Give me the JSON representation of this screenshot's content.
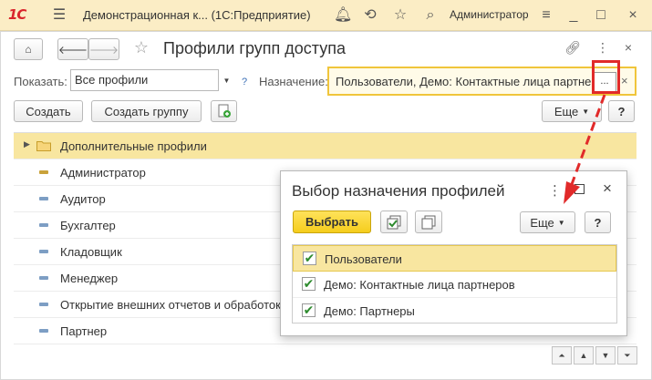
{
  "titlebar": {
    "logo": "1С",
    "title": "Демонстрационная к...  (1С:Предприятие)",
    "user": "Администратор"
  },
  "form": {
    "title": "Профили групп доступа",
    "filter": {
      "show_label": "Показать:",
      "show_value": "Все профили",
      "help": "?",
      "purpose_label": "Назначение:",
      "purpose_value": "Пользователи, Демо: Контактные лица партнер",
      "ellipsis": "...",
      "clear": "×"
    },
    "toolbar": {
      "create": "Создать",
      "create_group": "Создать группу",
      "more": "Еще",
      "help": "?"
    },
    "rows": [
      {
        "label": "Дополнительные профили",
        "kind": "folder",
        "selected": true
      },
      {
        "label": "Администратор",
        "kind": "item"
      },
      {
        "label": "Аудитор",
        "kind": "item"
      },
      {
        "label": "Бухгалтер",
        "kind": "item"
      },
      {
        "label": "Кладовщик",
        "kind": "item"
      },
      {
        "label": "Менеджер",
        "kind": "item"
      },
      {
        "label": "Открытие внешних отчетов и обработок",
        "kind": "item"
      },
      {
        "label": "Партнер",
        "kind": "item"
      }
    ]
  },
  "dialog": {
    "title": "Выбор назначения профилей",
    "select": "Выбрать",
    "more": "Еще",
    "help": "?",
    "items": [
      {
        "label": "Пользователи",
        "checked": true,
        "selected": true
      },
      {
        "label": "Демо: Контактные лица партнеров",
        "checked": true
      },
      {
        "label": "Демо: Партнеры",
        "checked": true
      }
    ]
  },
  "colors": {
    "accent_yellow": "#f5cd1c",
    "selection": "#f8e6a0",
    "highlight_red": "#e12a2a",
    "header_bg": "#fbedc5"
  }
}
